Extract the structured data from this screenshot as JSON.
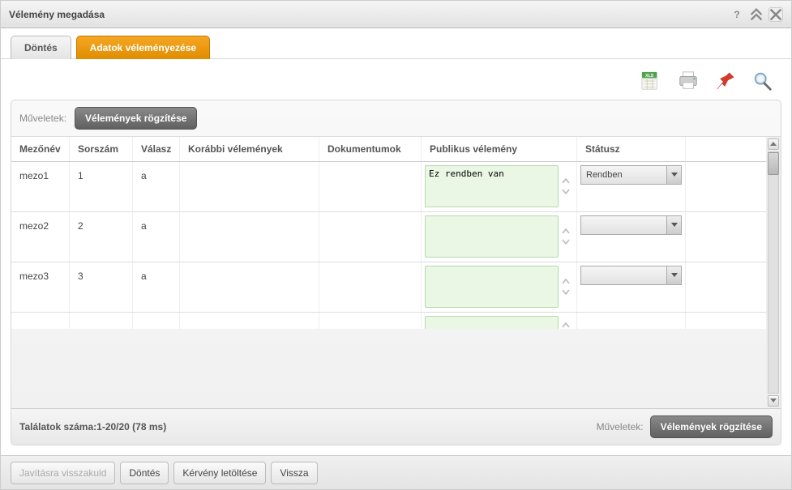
{
  "title": "Vélemény megadása",
  "tabs": {
    "decision": "Döntés",
    "review": "Adatok véleményezése"
  },
  "ops_label": "Műveletek:",
  "ops_button": "Vélemények rögzítése",
  "headers": {
    "mezo": "Mezőnév",
    "sor": "Sorszám",
    "val": "Válasz",
    "kor": "Korábbi vélemények",
    "dok": "Dokumentumok",
    "pub": "Publikus vélemény",
    "stat": "Státusz"
  },
  "rows": [
    {
      "mezo": "mezo1",
      "sor": "1",
      "val": "a",
      "kor": "",
      "dok": "",
      "pub": "Ez rendben van",
      "stat": "Rendben"
    },
    {
      "mezo": "mezo2",
      "sor": "2",
      "val": "a",
      "kor": "",
      "dok": "",
      "pub": "",
      "stat": ""
    },
    {
      "mezo": "mezo3",
      "sor": "3",
      "val": "a",
      "kor": "",
      "dok": "",
      "pub": "",
      "stat": ""
    },
    {
      "mezo": "",
      "sor": "",
      "val": "",
      "kor": "",
      "dok": "",
      "pub": "",
      "stat": ""
    }
  ],
  "results_text": "Találatok száma:1-20/20 (78 ms)",
  "footer_ops_label": "Műveletek:",
  "footer_ops_button": "Vélemények rögzítése",
  "bottom": {
    "reject": "Javításra visszakuld",
    "decision": "Döntés",
    "download": "Kérvény letöltése",
    "back": "Vissza"
  }
}
